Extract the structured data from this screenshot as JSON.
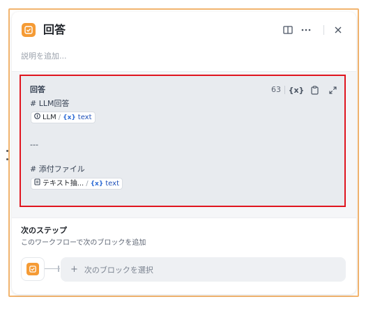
{
  "header": {
    "title": "回答",
    "description_placeholder": "説明を追加...",
    "icons": [
      "answer-node-icon",
      "book-icon",
      "more-icon",
      "close-icon"
    ]
  },
  "editor": {
    "label": "回答",
    "char_count": "63",
    "lines": {
      "heading1": "# LLM回答",
      "separator": "---",
      "heading2": "# 添付ファイル"
    },
    "var1": {
      "node": "LLM",
      "name": "text"
    },
    "var2": {
      "node": "テキスト抽...",
      "name": "text"
    },
    "icons": [
      "variable-icon",
      "clipboard-icon",
      "expand-icon"
    ]
  },
  "next_step": {
    "title": "次のステップ",
    "subtitle": "このワークフローで次のブロックを追加",
    "select_label": "次のブロックを選択"
  },
  "colors": {
    "accent_orange": "#f59b35",
    "highlight_red": "#e0141e",
    "variable_blue": "#1d4fb8"
  }
}
